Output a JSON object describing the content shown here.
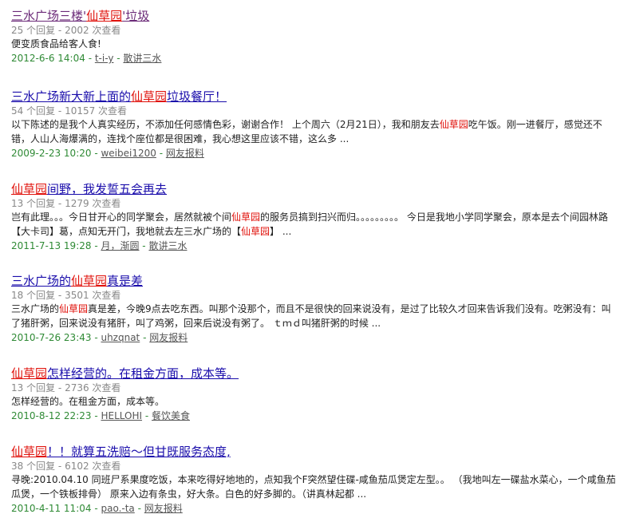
{
  "colors": {
    "title_visited": "#6b2a78",
    "title_link": "#1a0dab",
    "highlight": "#e0100a",
    "meta": "#888888",
    "date": "#2f8a35"
  },
  "results": [
    {
      "title_parts": [
        {
          "text": "三水广场三楼'",
          "hl": false
        },
        {
          "text": "仙草园",
          "hl": true
        },
        {
          "text": "'垃圾",
          "hl": false
        }
      ],
      "visited": true,
      "replies": "25 个回复",
      "views": "2002 次查看",
      "meta_sep": " - ",
      "snippet_parts": [
        {
          "text": "便变质食品给客人食!",
          "hl": false
        }
      ],
      "date": "2012-6-6 14:04",
      "author": "t-i-y",
      "category": "散讲三水",
      "sep": " - "
    },
    {
      "title_parts": [
        {
          "text": "三水广场新大新上面的",
          "hl": false
        },
        {
          "text": "仙草园",
          "hl": true
        },
        {
          "text": "垃圾餐厅！",
          "hl": false
        }
      ],
      "visited": false,
      "replies": "54 个回复",
      "views": "10157 次查看",
      "meta_sep": " - ",
      "snippet_parts": [
        {
          "text": "以下陈述的是我个人真实经历，不添加任何感情色彩，谢谢合作！ 上个周六（2月21日），我和朋友去",
          "hl": false
        },
        {
          "text": "仙草园",
          "hl": true
        },
        {
          "text": "吃午饭。刚一进餐厅，感觉还不错，人山人海爆满的，连找个座位都是很困难，我心想这里应该不错，这么多 ...",
          "hl": false
        }
      ],
      "date": "2009-2-23 10:20",
      "author": "weibei1200",
      "category": "网友报料",
      "sep": " - "
    },
    {
      "title_parts": [
        {
          "text": "仙草园",
          "hl": true
        },
        {
          "text": "间野，我发誓五会再去",
          "hl": false
        }
      ],
      "visited": false,
      "replies": "13 个回复",
      "views": "1279 次查看",
      "meta_sep": " - ",
      "snippet_parts": [
        {
          "text": "岂有此理。。。今日甘开心的同学聚会，居然就被个间",
          "hl": false
        },
        {
          "text": "仙草园",
          "hl": true
        },
        {
          "text": "的服务员搞到扫兴而归。。。。。。。。。 今日是我地小学同学聚会，原本是去个间园林路【大卡司】葛，点知无开门，我地就去左三水广场的【",
          "hl": false
        },
        {
          "text": "仙草园",
          "hl": true
        },
        {
          "text": "】 ...",
          "hl": false
        }
      ],
      "date": "2011-7-13 19:28",
      "author": "月，渐圆",
      "category": "散讲三水",
      "sep": " - "
    },
    {
      "title_parts": [
        {
          "text": "三水广场的",
          "hl": false
        },
        {
          "text": "仙草园",
          "hl": true
        },
        {
          "text": "真是差",
          "hl": false
        }
      ],
      "visited": false,
      "replies": "18 个回复",
      "views": "3501 次查看",
      "meta_sep": " - ",
      "snippet_parts": [
        {
          "text": "三水广场的",
          "hl": false
        },
        {
          "text": "仙草园",
          "hl": true
        },
        {
          "text": "真是差，今晚9点去吃东西。叫那个没那个，而且不是很快的回来说没有，是过了比较久才回来告诉我们没有。吃粥没有：叫了猪肝粥，回来说没有猪肝，叫了鸡粥，回来后说没有粥了。 ｔｍｄ叫猪肝粥的时候 ...",
          "hl": false
        }
      ],
      "date": "2010-7-26 23:43",
      "author": "uhzqnat",
      "category": "网友报料",
      "sep": " - "
    },
    {
      "title_parts": [
        {
          "text": "仙草园",
          "hl": true
        },
        {
          "text": "怎样经营的。在租金方面，成本等。",
          "hl": false
        }
      ],
      "visited": false,
      "replies": "13 个回复",
      "views": "2736 次查看",
      "meta_sep": " - ",
      "snippet_parts": [
        {
          "text": "怎样经营的。在租金方面，成本等。",
          "hl": false
        }
      ],
      "date": "2010-8-12 22:23",
      "author": "HELLOHI",
      "category": "餐饮美食",
      "sep": " - "
    },
    {
      "title_parts": [
        {
          "text": "仙草园",
          "hl": true
        },
        {
          "text": "！！就算五洗赔～但甘既服务态度,",
          "hl": false
        }
      ],
      "visited": false,
      "replies": "38 个回复",
      "views": "6102 次查看",
      "meta_sep": " - ",
      "snippet_parts": [
        {
          "text": "寻晚:2010.04.10 同班尸系果度吃饭，本来吃得好地地的，点知我个F突然望住碟-咸鱼茄瓜煲定左型。。 （我地叫左一碟盐水菜心，一个咸鱼茄瓜煲，一个铁板排骨） 原来入边有条虫，好大条。白色的好多脚的。（讲真林起都 ...",
          "hl": false
        }
      ],
      "date": "2010-4-11 11:04",
      "author": "pao.-ta",
      "category": "网友报料",
      "sep": " - "
    }
  ]
}
